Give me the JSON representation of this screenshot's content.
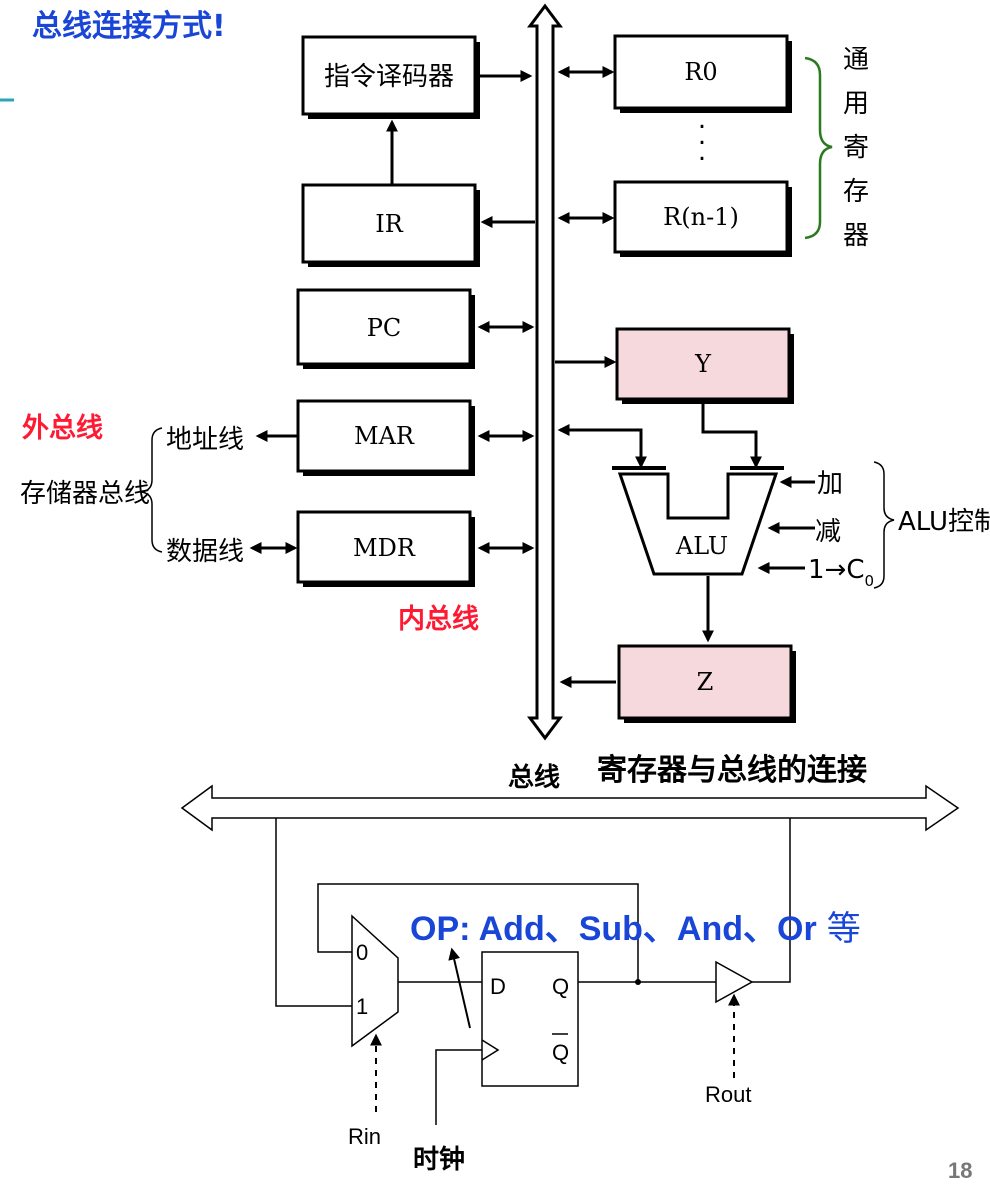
{
  "title": "总线连接方式!",
  "labels": {
    "decoder": "指令译码器",
    "ir": "IR",
    "pc": "PC",
    "mar": "MAR",
    "mdr": "MDR",
    "r0": "R0",
    "dots": ".",
    "rn1": "R(n-1)",
    "y": "Y",
    "alu": "ALU",
    "z": "Z",
    "general_registers": [
      "通",
      "用",
      "寄",
      "存",
      "器"
    ],
    "external_bus": "外总线",
    "memory_bus": "存储器总线",
    "address_line": "地址线",
    "data_line": "数据线",
    "internal_bus": "内总线",
    "add": "加",
    "sub": "减",
    "carry_in_main": "1→C",
    "carry_in_sub": "0",
    "alu_control": "ALU控制",
    "bus_label": "总线"
  },
  "bottom": {
    "title": "寄存器与总线的连接",
    "op": "OP: Add、Sub、And、Or",
    "op_suffix": "等",
    "mux_in0": "0",
    "mux_in1": "1",
    "ff_d": "D",
    "ff_q": "Q",
    "ff_qbar": "Q",
    "rin": "Rin",
    "rout": "Rout",
    "clock": "时钟"
  },
  "page_number": "18"
}
